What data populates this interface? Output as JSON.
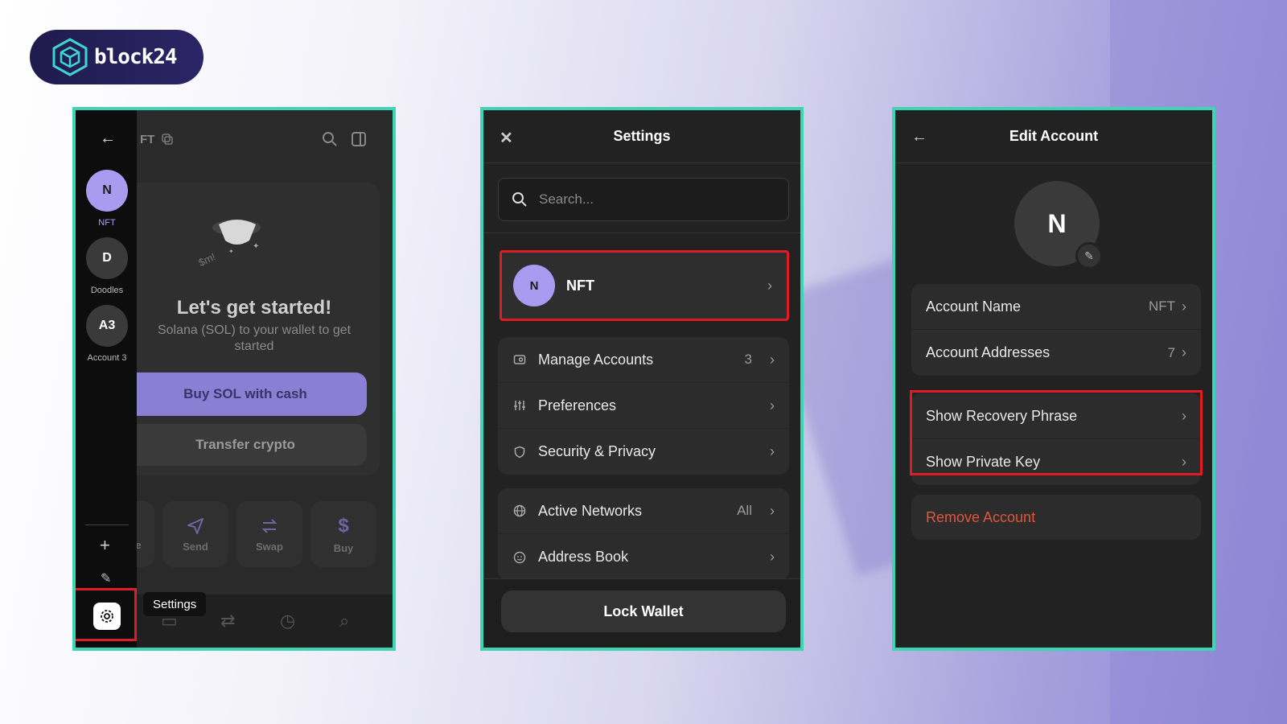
{
  "brand": {
    "name": "block24"
  },
  "panel1": {
    "header_title": "FT",
    "sidebar": {
      "accounts": [
        {
          "initials": "N",
          "name": "NFT",
          "active": true
        },
        {
          "initials": "D",
          "name": "Doodles",
          "active": false
        },
        {
          "initials": "A3",
          "name": "Account 3",
          "active": false
        }
      ]
    },
    "tooltip": "Settings",
    "heading": "Let's get started!",
    "subtext_line1": "Solana (SOL) to your wallet to get",
    "subtext_line2": "started",
    "buy_button": "Buy SOL with cash",
    "transfer_button": "Transfer crypto",
    "actions": [
      {
        "label": "e",
        "icon": "receive-icon"
      },
      {
        "label": "Send",
        "icon": "send-icon"
      },
      {
        "label": "Swap",
        "icon": "swap-icon"
      },
      {
        "label": "Buy",
        "icon": "dollar-icon"
      }
    ]
  },
  "panel2": {
    "title": "Settings",
    "search_placeholder": "Search...",
    "current_account": {
      "initials": "N",
      "name": "NFT"
    },
    "groups": [
      [
        {
          "icon": "manage-accounts-icon",
          "label": "Manage Accounts",
          "value": "3"
        },
        {
          "icon": "preferences-icon",
          "label": "Preferences",
          "value": ""
        },
        {
          "icon": "shield-icon",
          "label": "Security & Privacy",
          "value": ""
        }
      ],
      [
        {
          "icon": "globe-icon",
          "label": "Active Networks",
          "value": "All"
        },
        {
          "icon": "address-book-icon",
          "label": "Address Book",
          "value": ""
        }
      ]
    ],
    "lock_button": "Lock Wallet"
  },
  "panel3": {
    "title": "Edit Account",
    "avatar_initials": "N",
    "rows": [
      {
        "label": "Account Name",
        "value": "NFT"
      },
      {
        "label": "Account Addresses",
        "value": "7"
      }
    ],
    "secret_rows": [
      {
        "label": "Show Recovery Phrase"
      },
      {
        "label": "Show Private Key"
      }
    ],
    "remove_label": "Remove Account"
  },
  "colors": {
    "accent": "#a99cf0",
    "highlight_border": "#3cd6b4",
    "annotation_red": "#e01b24",
    "danger": "#e0553c"
  }
}
